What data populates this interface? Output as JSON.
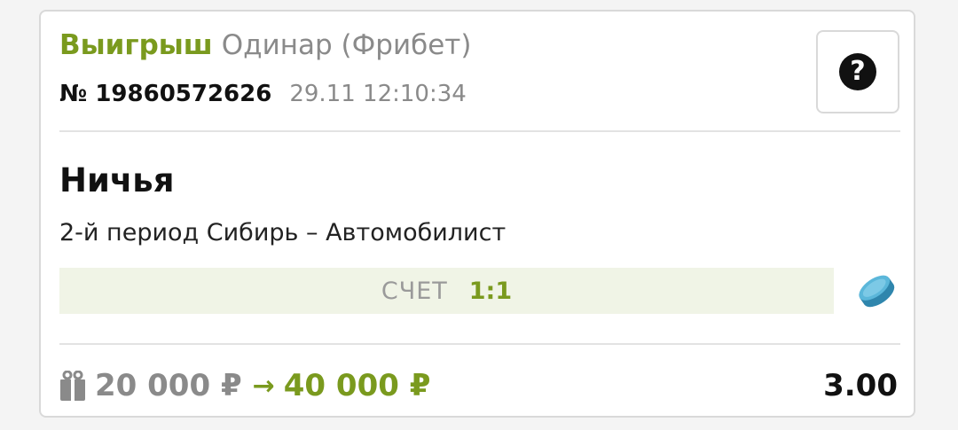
{
  "bet": {
    "status": "Выигрыш",
    "type": "Одинар (Фрибет)",
    "id": "№ 19860572626",
    "datetime": "29.11 12:10:34",
    "help_label": "?",
    "outcome": "Ничья",
    "event": "2-й период Сибирь – Автомобилист",
    "score_label": "СЧЕТ",
    "score_value": "1:1",
    "sport_icon": "hockey-puck-icon",
    "gift_icon": "gift-icon",
    "stake": "20 000 ₽",
    "arrow": "→",
    "payout": "40 000 ₽",
    "odds": "3.00"
  },
  "colors": {
    "accent_green": "#7a9a1e",
    "muted_gray": "#8a8a8a",
    "score_bg": "#f0f4e6",
    "puck_blue": "#4aa6cc"
  }
}
